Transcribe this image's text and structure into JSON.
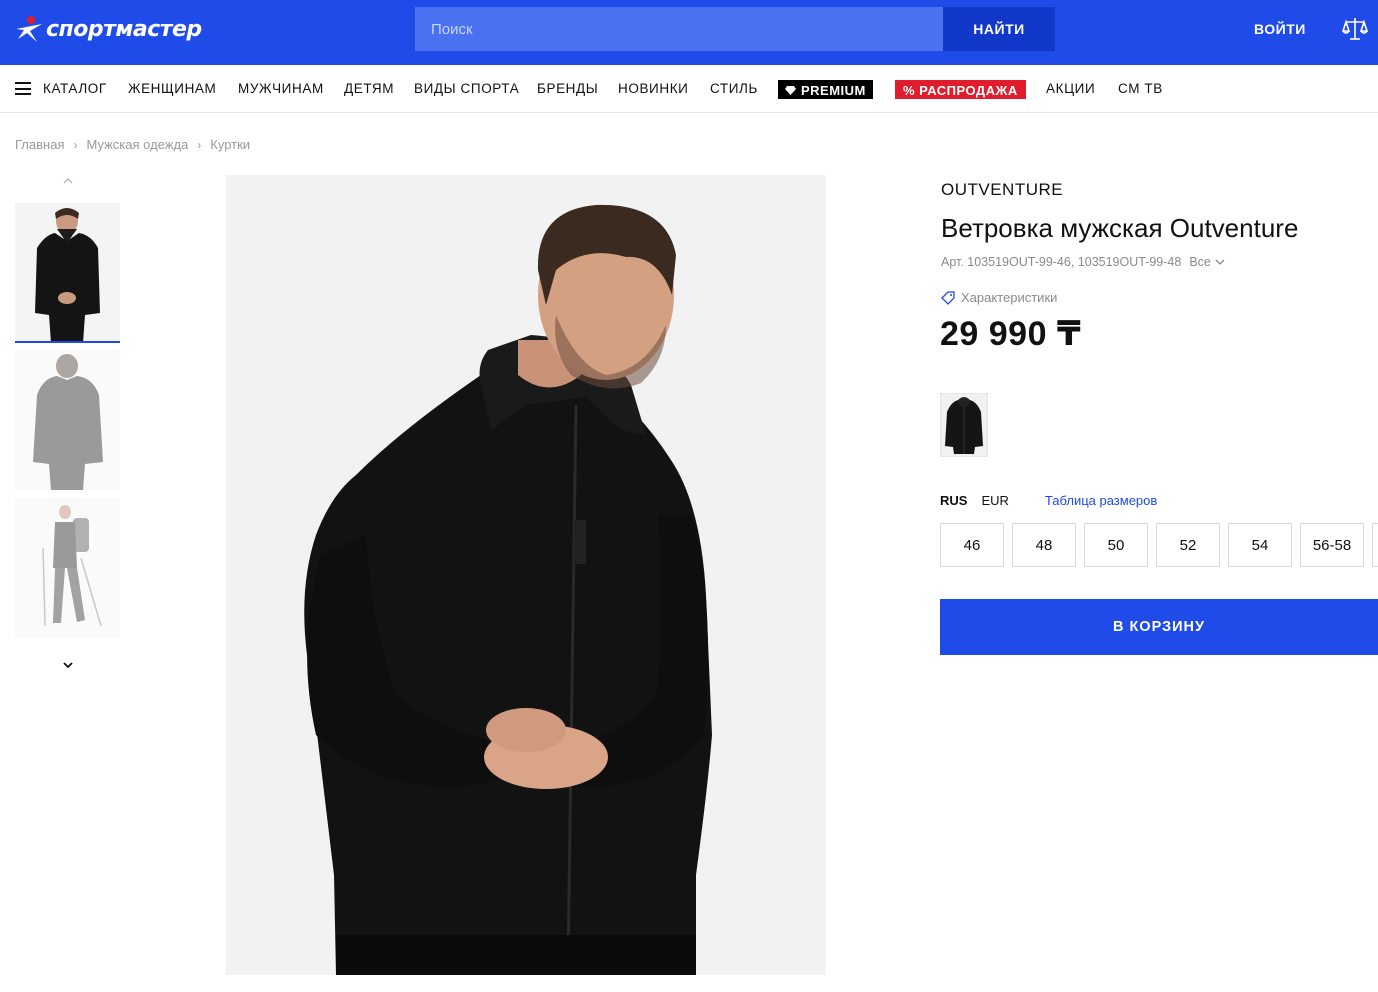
{
  "header": {
    "logo_text": "спортмастер",
    "search_placeholder": "Поиск",
    "search_button": "НАЙТИ",
    "login": "ВОЙТИ",
    "brand_color": "#1f4be8",
    "icons": [
      "logo-star-icon",
      "compare-scales-icon"
    ]
  },
  "nav": {
    "catalog": "КАТАЛОГ",
    "women": "ЖЕНЩИНАМ",
    "men": "МУЖЧИНАМ",
    "kids": "ДЕТЯМ",
    "sports": "ВИДЫ СПОРТА",
    "brands": "БРЕНДЫ",
    "new": "НОВИНКИ",
    "style": "СТИЛЬ",
    "premium": "PREMIUM",
    "sale": "% РАСПРОДАЖА",
    "promo": "АКЦИИ",
    "tv": "СМ ТВ",
    "sale_color": "#e11d2d"
  },
  "breadcrumb": [
    "Главная",
    "Мужская одежда",
    "Куртки"
  ],
  "product": {
    "brand": "OUTVENTURE",
    "title": "Ветровка мужская Outventure",
    "sku": "Арт. 103519OUT-99-46, 103519OUT-99-48",
    "sku_all": "Все",
    "specs": "Характеристики",
    "price": "29 990 ₸",
    "size_systems": [
      "RUS",
      "EUR"
    ],
    "size_table": "Таблица размеров",
    "sizes": [
      "46",
      "48",
      "50",
      "52",
      "54",
      "56-58"
    ],
    "add_to_cart": "В КОРЗИНУ"
  }
}
